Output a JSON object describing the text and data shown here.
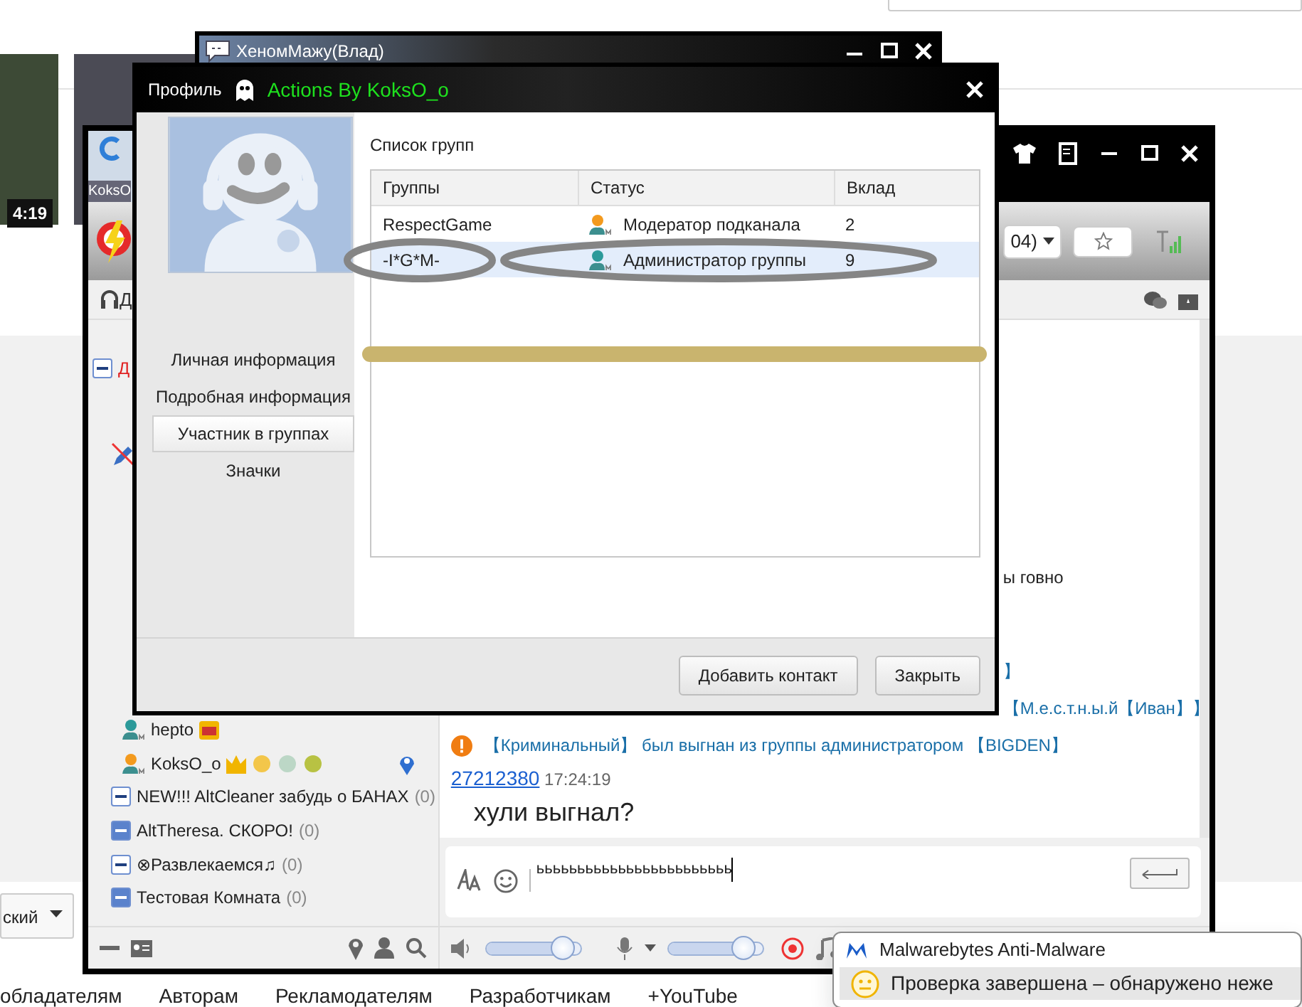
{
  "background_page": {
    "video_duration": "4:19",
    "language_dropdown": "ский",
    "footer_links": [
      "обладателям",
      "Авторам",
      "Рекламодателям",
      "Разработчикам",
      "+YouTube"
    ]
  },
  "back_window": {
    "title": "ХеномМажу(Влад)"
  },
  "chat_window": {
    "title_fragment": "KoksO",
    "tab_fragment": "Д",
    "room_selector": "04)",
    "contacts": [
      {
        "kind": "group",
        "name": "Д",
        "color": "#e02020",
        "highlighted": false
      },
      {
        "kind": "user",
        "name": "hepto",
        "color": "#2c9a9a",
        "located": false
      },
      {
        "kind": "user",
        "name": "KoksO_o",
        "color": "#f39a1e",
        "located": true
      },
      {
        "kind": "group",
        "name": "NEW!!! AltCleaner забудь о БАНАХ",
        "count": "(0)",
        "color": "#222222",
        "highlighted": false
      },
      {
        "kind": "group",
        "name": "AltTheresa. СКОРО!",
        "count": "(0)",
        "color": "#222222",
        "highlighted": true
      },
      {
        "kind": "group",
        "name": "⊗Развлекаемся♫",
        "count": "(0)",
        "color": "#222222",
        "highlighted": false
      },
      {
        "kind": "group",
        "name": "Тестовая Комната",
        "count": "(0)",
        "color": "#222222",
        "highlighted": true
      }
    ],
    "messages": [
      {
        "kind": "fragment",
        "text": "ы говно"
      },
      {
        "kind": "notice_fragment",
        "text": "】"
      },
      {
        "kind": "notice_fragment",
        "text": "【М.е.с.т.н.ы.й【Иван】】"
      },
      {
        "kind": "system",
        "text": "【Криминальный】 был выгнан из группы администратором 【BIGDEN】"
      },
      {
        "kind": "user",
        "sender": "27212380",
        "time": "17:24:19",
        "text": "хули выгнал?"
      }
    ],
    "input_value": "ьььььььььььььььььььььььь",
    "volume": {
      "level": 0.9
    },
    "mic": {
      "level": 0.88
    }
  },
  "profile_dialog": {
    "title": "Профиль",
    "caption": "Actions By KoksO_o",
    "nav": [
      {
        "label": "Личная информация",
        "selected": false
      },
      {
        "label": "Подробная информация",
        "selected": false
      },
      {
        "label": "Участник в группах",
        "selected": true
      },
      {
        "label": "Значки",
        "selected": false
      }
    ],
    "section_title": "Список групп",
    "columns": [
      "Группы",
      "Статус",
      "Вклад"
    ],
    "rows": [
      {
        "group": "RespectGame",
        "color": "#f39a1e",
        "status": "Модератор подканала",
        "contribution": "2",
        "selected": false
      },
      {
        "group": "-I*G*M-",
        "color": "#2c9a9a",
        "status": "Администратор группы",
        "contribution": "9",
        "selected": true
      }
    ],
    "buttons": [
      "Добавить контакт",
      "Закрыть"
    ]
  },
  "notification": {
    "app": "Malwarebytes Anti-Malware",
    "message": "Проверка завершена – обнаружено неже"
  }
}
